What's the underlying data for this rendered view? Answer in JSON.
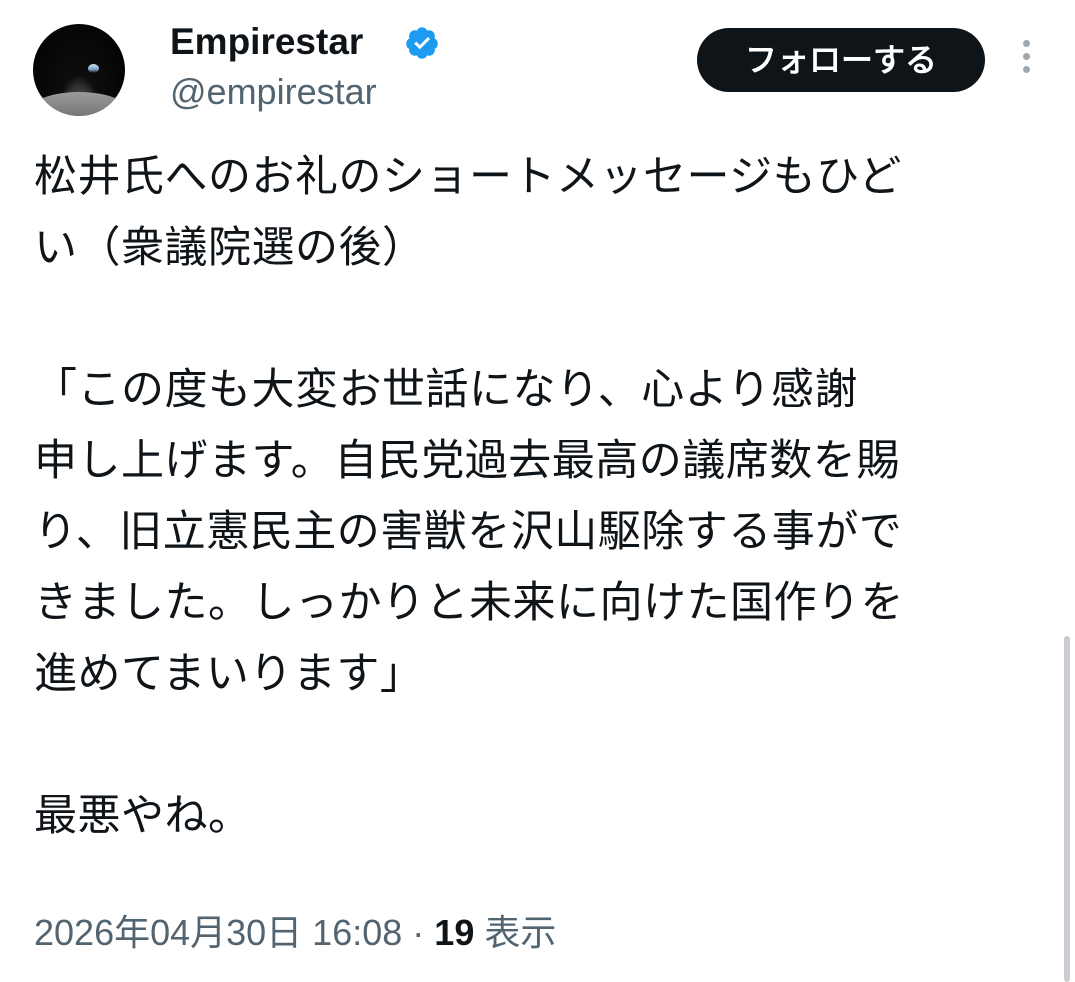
{
  "user": {
    "display_name": "Empirestar",
    "handle": "@empirestar",
    "verified_icon": "verified-badge-icon",
    "verified_color": "#1d9bf0"
  },
  "actions": {
    "follow_label": "フォローする",
    "more_icon": "vertical-ellipsis-icon"
  },
  "tweet": {
    "lines": [
      "松井氏へのお礼のショートメッセージもひど",
      "い（衆議院選の後）",
      "",
      "「この度も大変お世話になり、心より感謝",
      "申し上げます。自民党過去最高の議席数を賜",
      "り、旧立憲民主の害獣を沢山駆除する事がで",
      "きました。しっかりと未来に向けた国作りを",
      "進めてまいります」",
      "",
      "最悪やね。"
    ]
  },
  "meta": {
    "timestamp": "2026年04月30日 16:08",
    "separator": "·",
    "views_count": "19",
    "views_label": "表示"
  },
  "colors": {
    "text": "#0f1419",
    "secondary": "#536471",
    "button_bg": "#0f1419",
    "button_text": "#ffffff"
  }
}
